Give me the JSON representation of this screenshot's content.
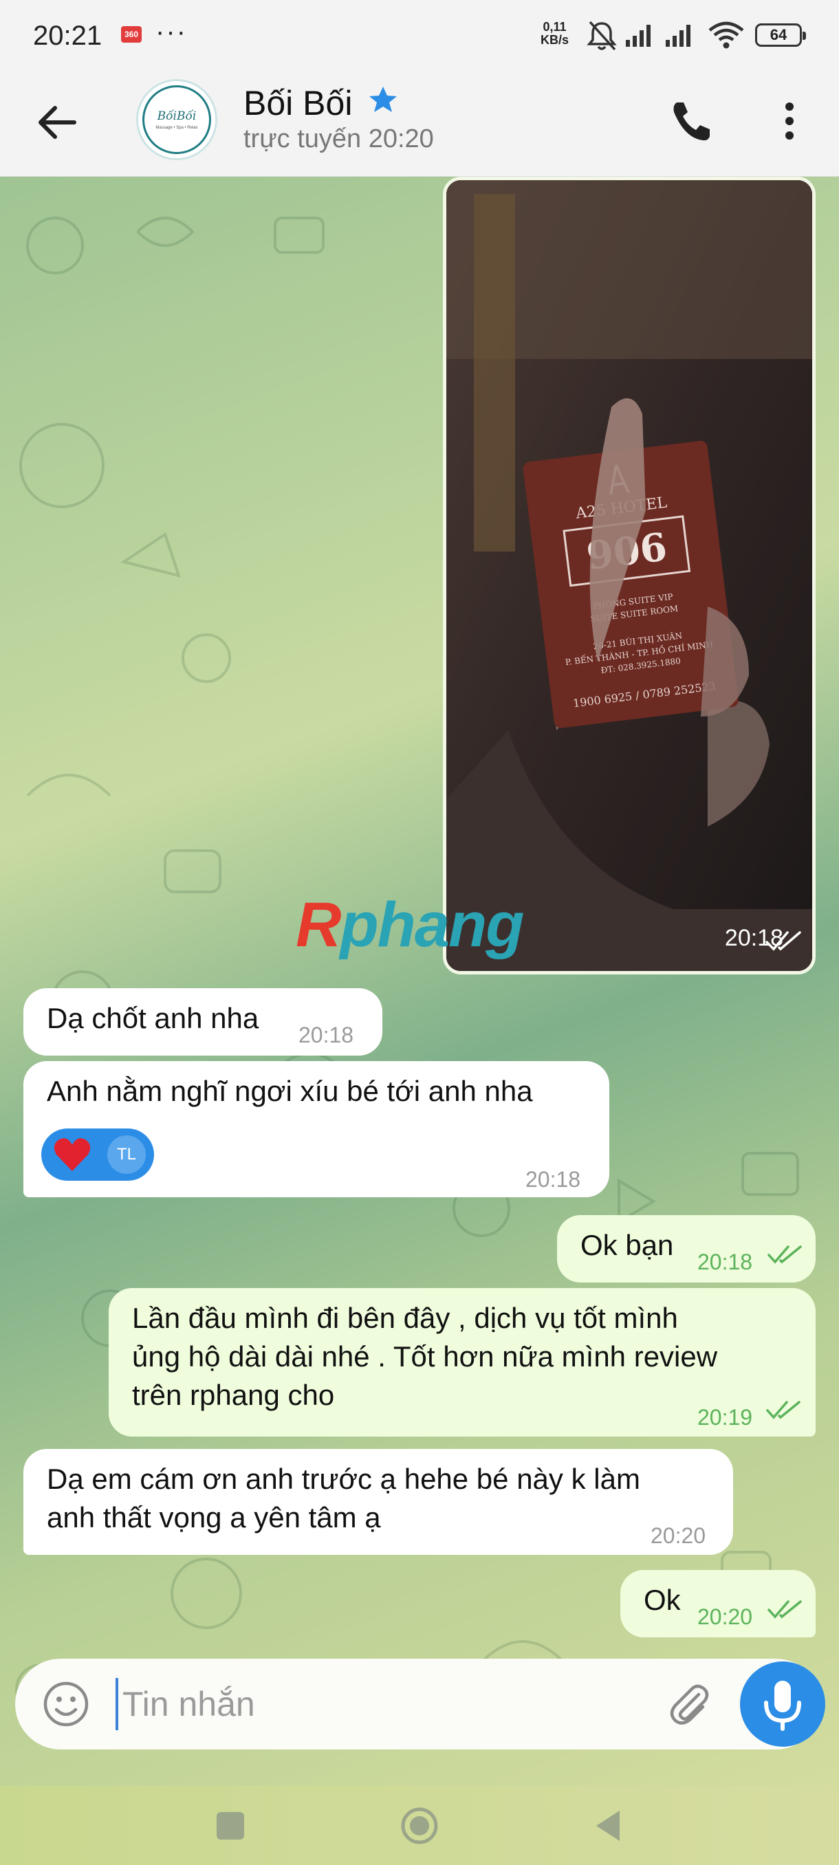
{
  "status_bar": {
    "time": "20:21",
    "app_badge": "360",
    "more_dots": "···",
    "net_speed_value": "0,11",
    "net_speed_unit": "KB/s",
    "battery": "64"
  },
  "header": {
    "contact_name": "Bối Bối",
    "contact_status": "trực tuyến 20:20",
    "avatar_logo": "BốiBối",
    "avatar_sub": "Massage • Spa • Relax"
  },
  "photo": {
    "card_brand": "A25 HOTEL",
    "card_room": "906",
    "card_line1": "PHÒNG SUITE VIP",
    "card_line2": "SUITE SUITE ROOM",
    "card_addr1": "20-21 BÙI THỊ XUÂN",
    "card_addr2": "P. BẾN THÀNH - TP. HỒ CHÍ MINH",
    "card_addr3": "ĐT: 028.3925.1880",
    "card_phone": "1900 6925 / 0789 252523",
    "time": "20:18"
  },
  "watermark": {
    "first": "R",
    "rest": "phang"
  },
  "messages": [
    {
      "direction": "incoming",
      "text": "Dạ chốt anh nha",
      "time": "20:18"
    },
    {
      "direction": "incoming",
      "text": "Anh nằm nghĩ ngơi xíu bé tới anh nha",
      "time": "20:18",
      "reaction": {
        "emoji": "heart",
        "user_initials": "TL"
      }
    },
    {
      "direction": "outgoing",
      "text": "Ok bạn",
      "time": "20:18",
      "status": "read"
    },
    {
      "direction": "outgoing",
      "line1": "Lần đầu mình đi bên đây , dịch vụ tốt mình",
      "line2": "ủng hộ dài dài nhé . Tốt hơn nữa mình review",
      "line3": "trên rphang cho",
      "time": "20:19",
      "status": "read"
    },
    {
      "direction": "incoming",
      "line1": "Dạ em cám ơn anh trước ạ hehe bé này k làm",
      "line2": "anh thất vọng a yên tâm ạ",
      "time": "20:20"
    },
    {
      "direction": "outgoing",
      "text": "Ok",
      "time": "20:20",
      "status": "read"
    }
  ],
  "input": {
    "placeholder": "Tin nhắn"
  },
  "colors": {
    "accent": "#2b8de6",
    "outgoing_bubble": "#effddd",
    "incoming_bubble": "#ffffff",
    "read_check": "#5cb35b"
  },
  "icons": [
    "back-arrow-icon",
    "verified-star-icon",
    "phone-icon",
    "more-vertical-icon",
    "emoji-icon",
    "paperclip-icon",
    "microphone-icon",
    "double-check-icon",
    "heart-icon",
    "nav-recents-icon",
    "nav-home-icon",
    "nav-back-icon"
  ]
}
